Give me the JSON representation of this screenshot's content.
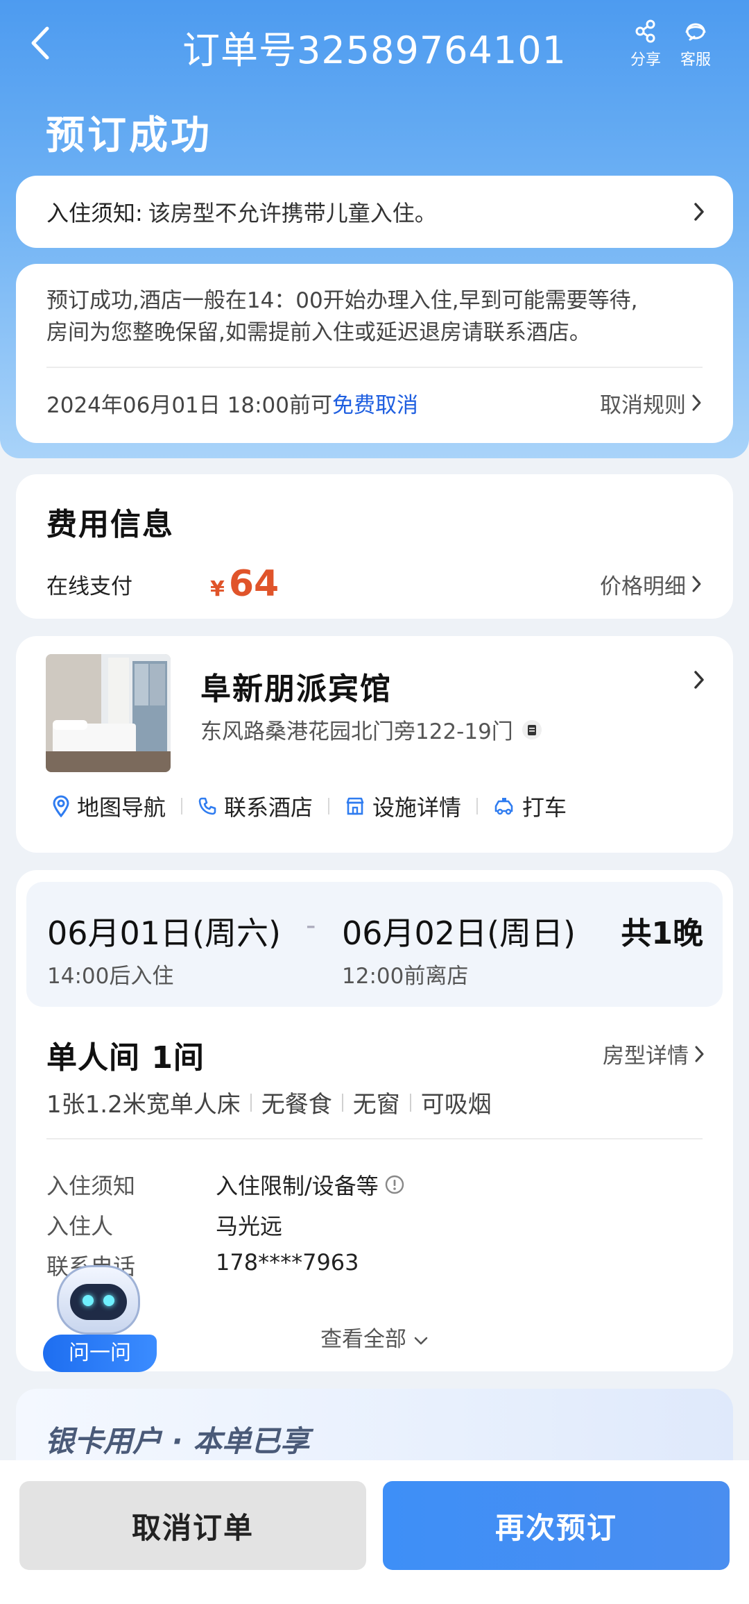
{
  "header": {
    "order_title": "订单号32589764101",
    "share_label": "分享",
    "service_label": "客服",
    "status": "预订成功"
  },
  "notice": {
    "key": "入住须知:",
    "value": "该房型不允许携带儿童入住。"
  },
  "checkin_info": {
    "line1": "预订成功,酒店一般在14：00开始办理入住,早到可能需要等待,",
    "line2": "房间为您整晚保留,如需提前入住或延迟退房请联系酒店。",
    "cancel_prefix": "2024年06月01日 18:00前可",
    "cancel_free": "免费取消",
    "cancel_rule": "取消规则"
  },
  "fee": {
    "title": "费用信息",
    "pay_method": "在线支付",
    "currency": "¥",
    "amount": "64",
    "detail_link": "价格明细"
  },
  "hotel": {
    "name": "阜新朋派宾馆",
    "address": "东风路桑港花园北门旁122-19门",
    "actions": [
      "地图导航",
      "联系酒店",
      "设施详情",
      "打车"
    ]
  },
  "stay": {
    "checkin_date": "06月01日(周六)",
    "checkin_time": "14:00后入住",
    "separator": "-",
    "checkout_date": "06月02日(周日)",
    "checkout_time": "12:00前离店",
    "nights": "共1晚"
  },
  "room": {
    "title": "单人间 1间",
    "detail_link": "房型详情",
    "tags": [
      "1张1.2米宽单人床",
      "无餐食",
      "无窗",
      "可吸烟"
    ],
    "rows": [
      {
        "key": "入住须知",
        "value": "入住限制/设备等"
      },
      {
        "key": "入住人",
        "value": "马光远"
      },
      {
        "key": "联系电话",
        "value": "178****7963"
      }
    ],
    "view_all": "查看全部"
  },
  "assistant": {
    "label": "问一问"
  },
  "vip": {
    "text": "银卡用户 · 本单已享"
  },
  "footer": {
    "cancel_label": "取消订单",
    "rebook_label": "再次预订"
  },
  "colors": {
    "brand_blue": "#4d9bf0",
    "price_orange": "#e0542a",
    "link_blue": "#1f5fe0"
  }
}
